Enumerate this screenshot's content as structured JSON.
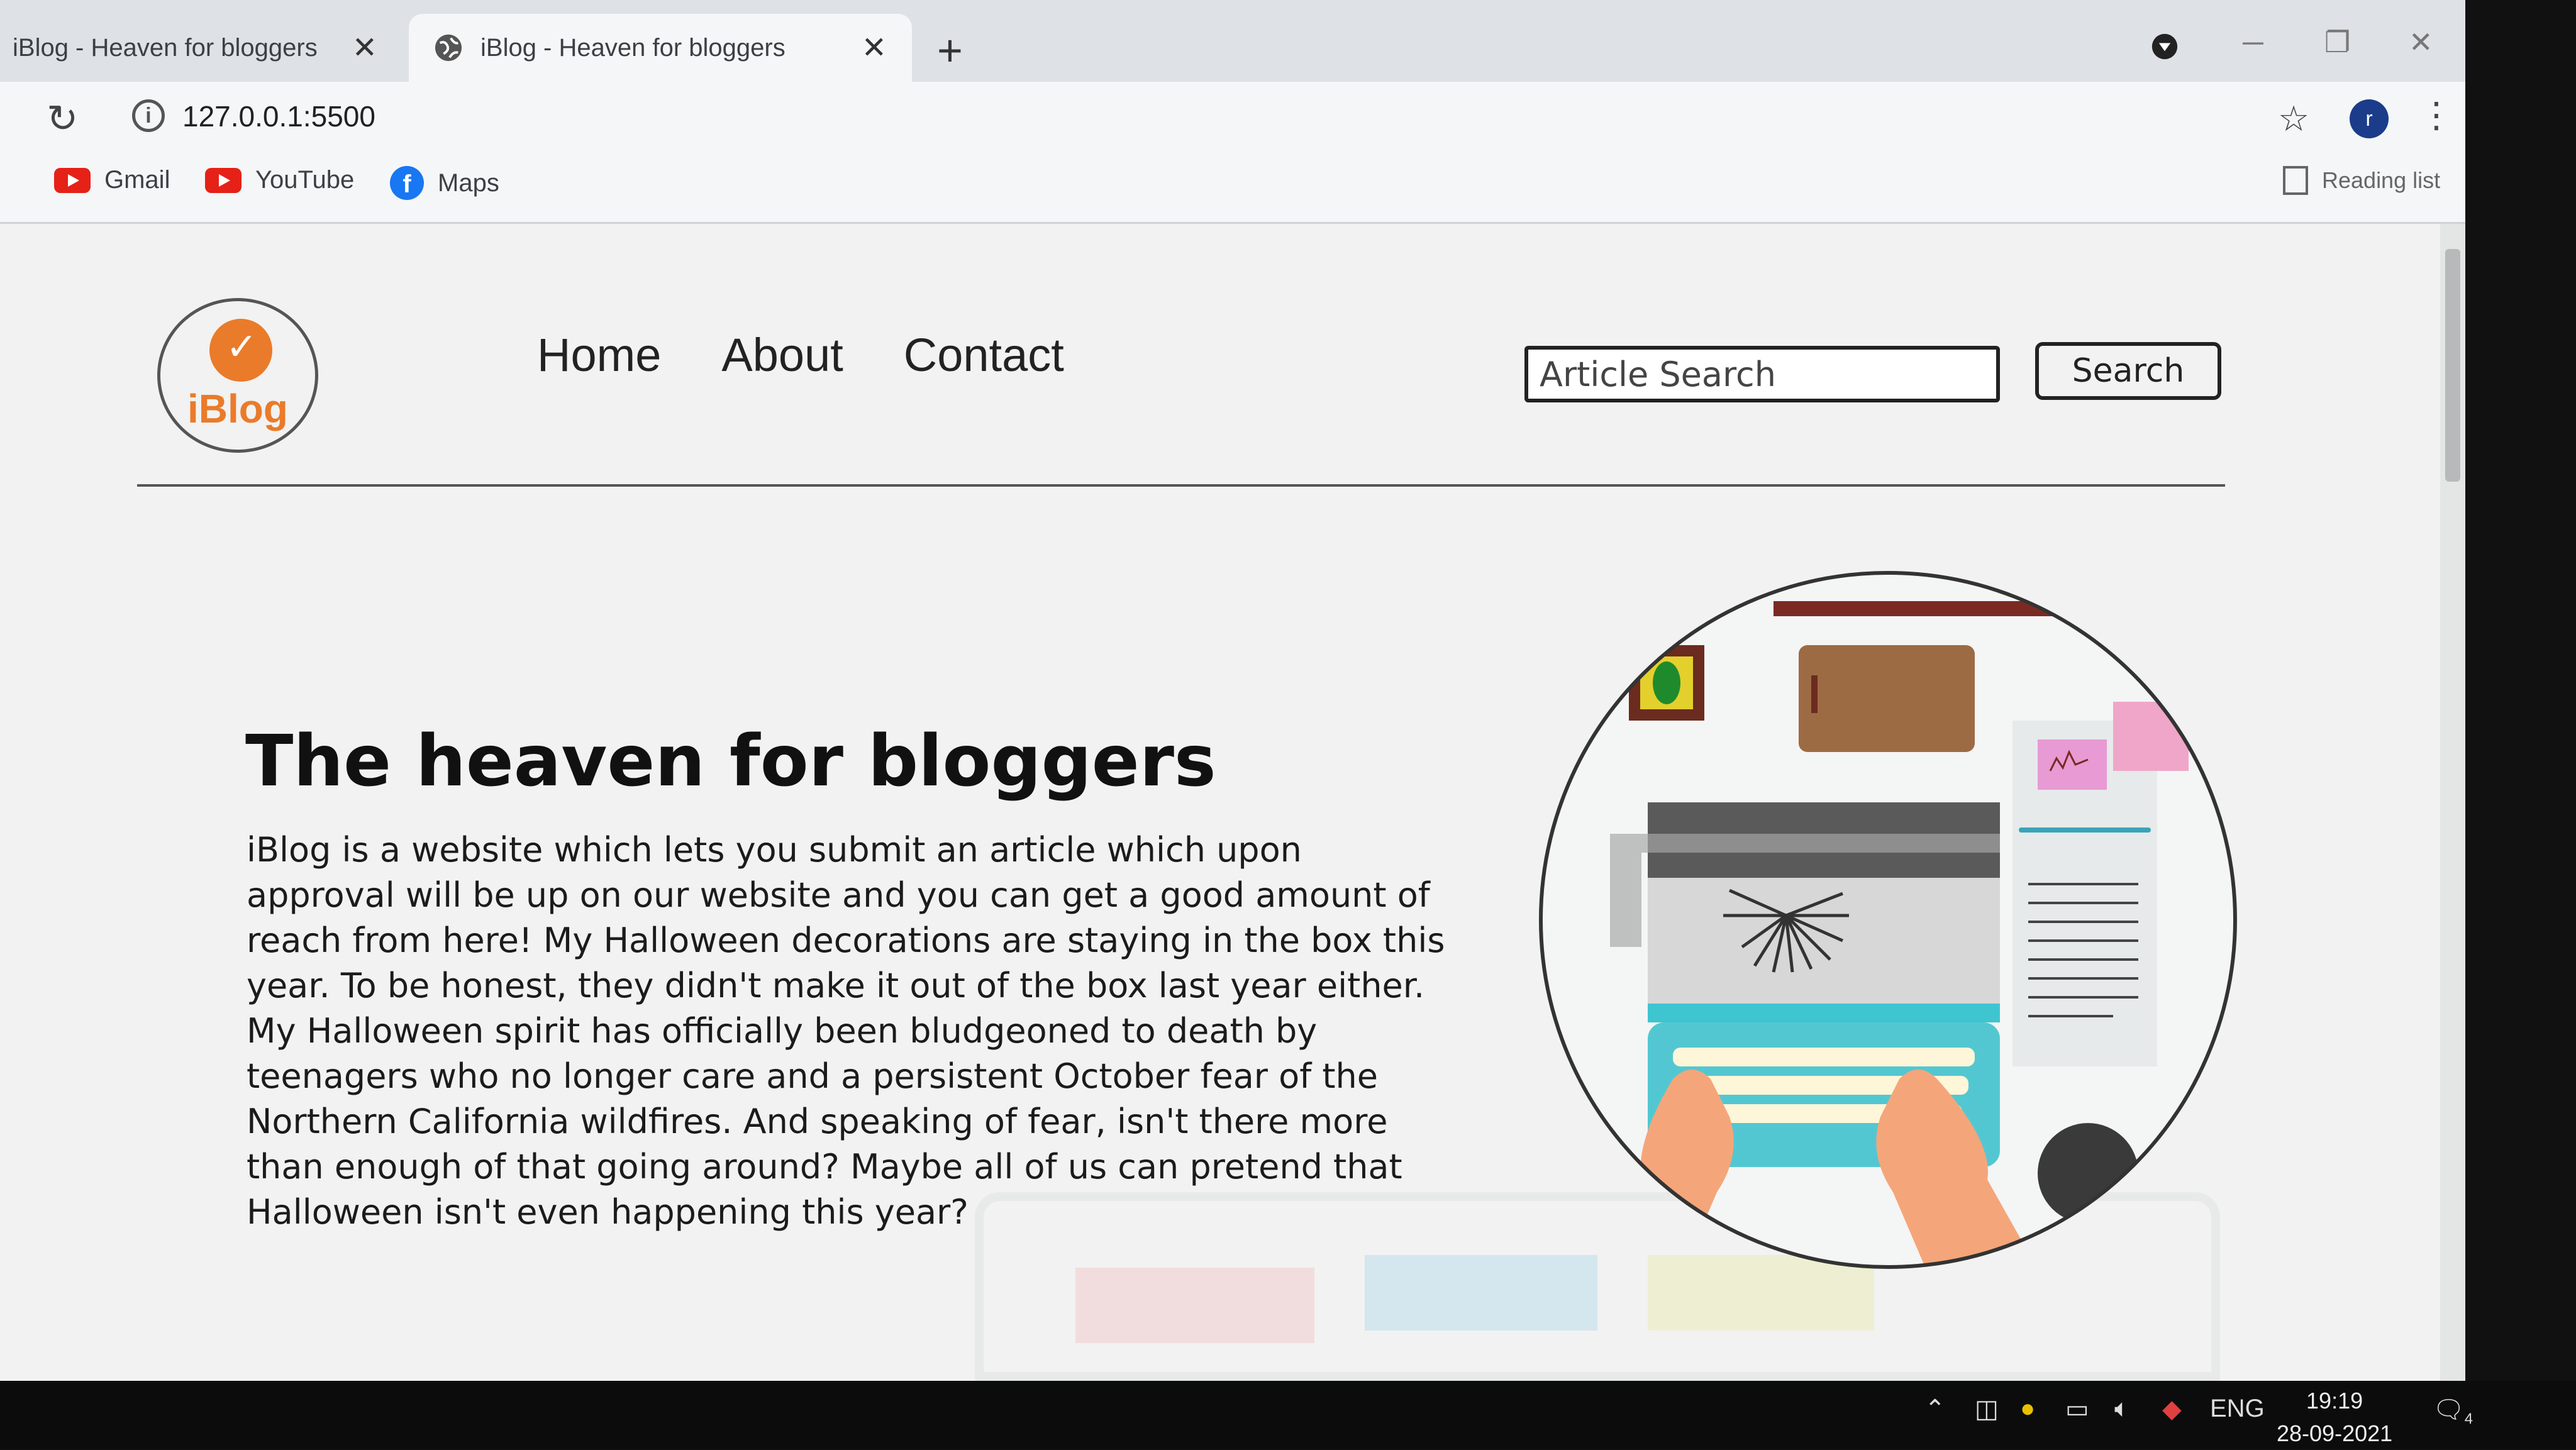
{
  "browser": {
    "tabs": [
      {
        "title": "iBlog - Heaven for bloggers",
        "active": false
      },
      {
        "title": "iBlog - Heaven for bloggers",
        "active": true
      }
    ],
    "new_tab_label": "+",
    "address": "127.0.0.1:5500",
    "profile_initial": "r",
    "bookmarks": [
      {
        "label": "Gmail",
        "icon": "youtube-icon"
      },
      {
        "label": "YouTube",
        "icon": "youtube-icon"
      },
      {
        "label": "Maps",
        "icon": "facebook-icon"
      }
    ],
    "reading_list_label": "Reading list"
  },
  "site": {
    "logo_text": "iBlog",
    "nav": [
      "Home",
      "About",
      "Contact"
    ],
    "search_placeholder": "Article Search",
    "search_button": "Search",
    "hero_title": "The heaven for bloggers",
    "hero_text": "iBlog is a website which lets you submit an article which upon approval will be up on our website and you can get a good amount of reach from here! My Halloween decorations are staying in the box this year. To be honest, they didn't make it out of the box last year either. My Halloween spirit has officially been bludgeoned to death by teenagers who no longer care and a persistent October fear of the Northern California wildfires. And speaking of fear, isn't there more than enough of that going around? Maybe all of us can pretend that Halloween isn't even happening this year?"
  },
  "taskbar": {
    "language": "ENG",
    "time": "19:19",
    "date": "28-09-2021",
    "notification_count": "4"
  },
  "colors": {
    "brand_orange": "#ea7b2a",
    "page_bg": "#f1f2f1",
    "chrome_bg": "#dee1e6"
  }
}
